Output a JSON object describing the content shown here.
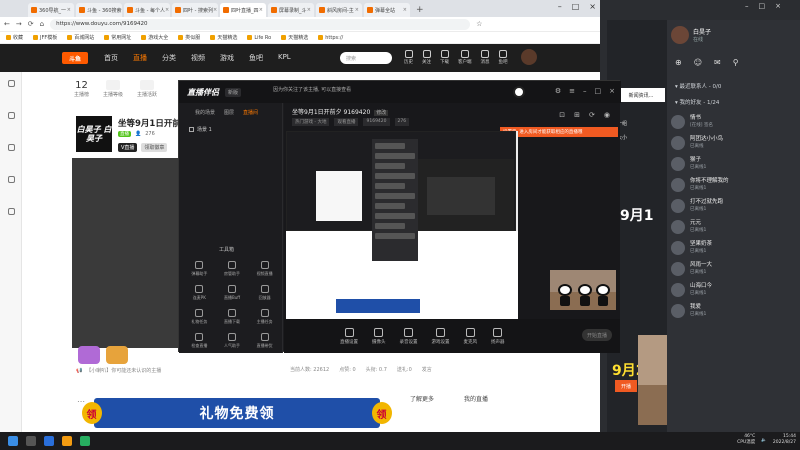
{
  "browser": {
    "tabs": [
      {
        "label": "360导航_一"
      },
      {
        "label": "斗鱼 - 360搜索"
      },
      {
        "label": "斗鱼 - 每个人"
      },
      {
        "label": "四叶 - 搜索列"
      },
      {
        "label": "四叶直播_四"
      },
      {
        "label": "屏幕录制_斗"
      },
      {
        "label": "斜风房间-主"
      },
      {
        "label": "弹幕全站"
      }
    ],
    "url": "https://www.douyu.com/9169420",
    "bookmarks": [
      "收藏",
      "JFF模板",
      "百城网站",
      "常用网址",
      "游戏大全",
      "类似服",
      "天猫精选",
      "Life Ro",
      "天猫精选",
      "https://"
    ]
  },
  "douyu": {
    "logo": "斗鱼",
    "nav": [
      "首页",
      "直播",
      "分类",
      "视频",
      "游戏",
      "鱼吧",
      "KPL"
    ],
    "search_placeholder": "搜索",
    "header_icons": [
      "历史",
      "关注",
      "下载",
      "客户端",
      "消息",
      "鱼吧"
    ],
    "stats": [
      {
        "num": "12",
        "label": "主播榜"
      },
      {
        "label": "主播等级"
      },
      {
        "label": "主播活跃"
      }
    ],
    "room_avatar_text": "白昊子 白昊子",
    "room_title": "坐等9月1日开前夕",
    "room_tag": "直播",
    "room_followers": "276",
    "btn_follow": "V直播",
    "btn_more": "领取徽章",
    "chat_placeholder": "【小喇叭】你可能还未认识的主播",
    "status_items": [
      "当前人数: 22612",
      "点赞: 0",
      "头衔: 0.7",
      "送礼:0",
      "发言"
    ],
    "banner_text": "礼物免费领",
    "coin": "领",
    "bottom_tabs": [
      "了解更多",
      "我的直播"
    ]
  },
  "app": {
    "title": "直播伴侣",
    "version": "新版",
    "notice": "因为你关注了该主播, 可以直接查看",
    "scene_tabs": [
      "我的场景",
      "图层",
      "直播间"
    ],
    "scene_item": "场景 1",
    "tools_title": "工具箱",
    "tools": [
      "弹幕助手",
      "房管助手",
      "视频直播",
      "连麦PK",
      "直播Buff",
      "回放器",
      "礼物任务",
      "直播下载",
      "主播任务",
      "检查直播",
      "人气助手",
      "直播带货"
    ],
    "room_title": "坐等9月1日开前夕 9169420",
    "room_edit": "修改",
    "room_tags": [
      "热门游戏 - 大地",
      "观看直播",
      "9169420",
      "276"
    ],
    "orange_tip": "设置后, 进入房间才能获取相应的直播哦",
    "bottom_tools": [
      "直播设置",
      "摄像头",
      "录音设置",
      "游戏设置",
      "麦克风",
      "扬声器"
    ],
    "go_live": "开始直播"
  },
  "friends": {
    "me": {
      "name": "白昊子",
      "status": "在线"
    },
    "groups": [
      {
        "label": "▾ 最近联系人 - 0/0"
      },
      {
        "label": "▾ 我的好友 - 1/24"
      }
    ],
    "list": [
      {
        "name": "情书",
        "status": "[在线] 签名"
      },
      {
        "name": "阿团达小小鸟",
        "status": "已离线"
      },
      {
        "name": "猴子",
        "status": "已离线1"
      },
      {
        "name": "你将不理解我的",
        "status": "已离线1"
      },
      {
        "name": "打不过就先跑",
        "status": "已离线1"
      },
      {
        "name": "元元",
        "status": "已离线1"
      },
      {
        "name": "坚果奶茶",
        "status": "已离线1"
      },
      {
        "name": "风雨一大",
        "status": "已离线1"
      },
      {
        "name": "山海口今",
        "status": "已离线1"
      },
      {
        "name": "我爱",
        "status": "已离线1"
      }
    ]
  },
  "mid": {
    "card": "新闻资讯...",
    "texts": [
      "一组",
      "大小",
      "9月1",
      "9月2"
    ],
    "date": "9月27",
    "live": "开播"
  },
  "game": {
    "score_top": "9月",
    "score_bot": "开赛"
  },
  "taskbar": {
    "temp": "46°C",
    "cpu": "CPU温度",
    "time": "15:44",
    "date": "2022/8/27"
  }
}
